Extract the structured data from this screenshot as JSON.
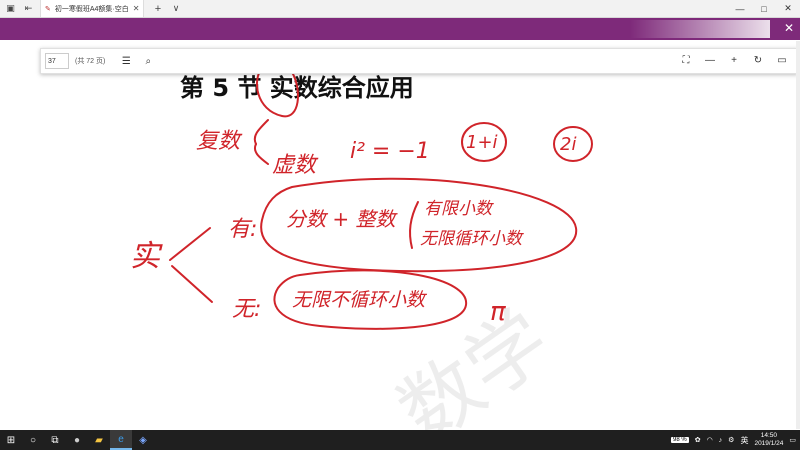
{
  "titlebar": {
    "tab_title": "初一寒假班A4额集·空白",
    "new_tab": "+",
    "dropdown": "∨",
    "minimize": "—",
    "maximize": "□",
    "close": "✕"
  },
  "purplebar": {
    "close": "✕"
  },
  "toolbar": {
    "page_value": "37",
    "page_total": "(共 72 页)",
    "list_icon": "list-icon",
    "search_icon": "search-icon",
    "fit_icon": "fit-page-icon",
    "zoom_out": "—",
    "zoom_in": "+",
    "rotate_icon": "rotate-icon",
    "twopage_icon": "two-page-icon"
  },
  "doc": {
    "heading": "第 5 节 实数综合应用",
    "hw": {
      "complex": "复数",
      "imaginary": "虚数",
      "i_squared": "i² = −1",
      "ex1": "1+i",
      "ex2": "2i",
      "real": "实",
      "have": "有:",
      "fraction_finite": "分数 + 整数",
      "finite_decimal": "有限小数",
      "repeating_decimal": "无限循环小数",
      "none": "无:",
      "irrational": "无限不循环小数",
      "pi": "π"
    },
    "watermark": "数学"
  },
  "taskbar": {
    "battery": "98 %",
    "ime": "英",
    "time": "14:50",
    "date": "2019/1/24"
  },
  "colors": {
    "purple": "#7e2a7a",
    "ink": "#d0242a",
    "taskbar": "#1f1f1f"
  }
}
